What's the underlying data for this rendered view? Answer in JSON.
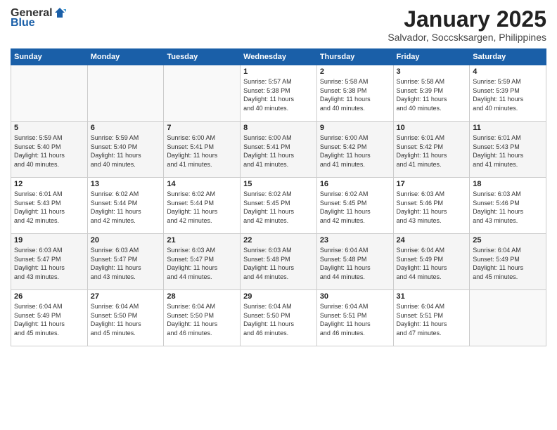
{
  "header": {
    "logo_general": "General",
    "logo_blue": "Blue",
    "title": "January 2025",
    "subtitle": "Salvador, Soccsksargen, Philippines"
  },
  "calendar": {
    "days_of_week": [
      "Sunday",
      "Monday",
      "Tuesday",
      "Wednesday",
      "Thursday",
      "Friday",
      "Saturday"
    ],
    "weeks": [
      [
        {
          "day": "",
          "content": ""
        },
        {
          "day": "",
          "content": ""
        },
        {
          "day": "",
          "content": ""
        },
        {
          "day": "1",
          "content": "Sunrise: 5:57 AM\nSunset: 5:38 PM\nDaylight: 11 hours\nand 40 minutes."
        },
        {
          "day": "2",
          "content": "Sunrise: 5:58 AM\nSunset: 5:38 PM\nDaylight: 11 hours\nand 40 minutes."
        },
        {
          "day": "3",
          "content": "Sunrise: 5:58 AM\nSunset: 5:39 PM\nDaylight: 11 hours\nand 40 minutes."
        },
        {
          "day": "4",
          "content": "Sunrise: 5:59 AM\nSunset: 5:39 PM\nDaylight: 11 hours\nand 40 minutes."
        }
      ],
      [
        {
          "day": "5",
          "content": "Sunrise: 5:59 AM\nSunset: 5:40 PM\nDaylight: 11 hours\nand 40 minutes."
        },
        {
          "day": "6",
          "content": "Sunrise: 5:59 AM\nSunset: 5:40 PM\nDaylight: 11 hours\nand 40 minutes."
        },
        {
          "day": "7",
          "content": "Sunrise: 6:00 AM\nSunset: 5:41 PM\nDaylight: 11 hours\nand 41 minutes."
        },
        {
          "day": "8",
          "content": "Sunrise: 6:00 AM\nSunset: 5:41 PM\nDaylight: 11 hours\nand 41 minutes."
        },
        {
          "day": "9",
          "content": "Sunrise: 6:00 AM\nSunset: 5:42 PM\nDaylight: 11 hours\nand 41 minutes."
        },
        {
          "day": "10",
          "content": "Sunrise: 6:01 AM\nSunset: 5:42 PM\nDaylight: 11 hours\nand 41 minutes."
        },
        {
          "day": "11",
          "content": "Sunrise: 6:01 AM\nSunset: 5:43 PM\nDaylight: 11 hours\nand 41 minutes."
        }
      ],
      [
        {
          "day": "12",
          "content": "Sunrise: 6:01 AM\nSunset: 5:43 PM\nDaylight: 11 hours\nand 42 minutes."
        },
        {
          "day": "13",
          "content": "Sunrise: 6:02 AM\nSunset: 5:44 PM\nDaylight: 11 hours\nand 42 minutes."
        },
        {
          "day": "14",
          "content": "Sunrise: 6:02 AM\nSunset: 5:44 PM\nDaylight: 11 hours\nand 42 minutes."
        },
        {
          "day": "15",
          "content": "Sunrise: 6:02 AM\nSunset: 5:45 PM\nDaylight: 11 hours\nand 42 minutes."
        },
        {
          "day": "16",
          "content": "Sunrise: 6:02 AM\nSunset: 5:45 PM\nDaylight: 11 hours\nand 42 minutes."
        },
        {
          "day": "17",
          "content": "Sunrise: 6:03 AM\nSunset: 5:46 PM\nDaylight: 11 hours\nand 43 minutes."
        },
        {
          "day": "18",
          "content": "Sunrise: 6:03 AM\nSunset: 5:46 PM\nDaylight: 11 hours\nand 43 minutes."
        }
      ],
      [
        {
          "day": "19",
          "content": "Sunrise: 6:03 AM\nSunset: 5:47 PM\nDaylight: 11 hours\nand 43 minutes."
        },
        {
          "day": "20",
          "content": "Sunrise: 6:03 AM\nSunset: 5:47 PM\nDaylight: 11 hours\nand 43 minutes."
        },
        {
          "day": "21",
          "content": "Sunrise: 6:03 AM\nSunset: 5:47 PM\nDaylight: 11 hours\nand 44 minutes."
        },
        {
          "day": "22",
          "content": "Sunrise: 6:03 AM\nSunset: 5:48 PM\nDaylight: 11 hours\nand 44 minutes."
        },
        {
          "day": "23",
          "content": "Sunrise: 6:04 AM\nSunset: 5:48 PM\nDaylight: 11 hours\nand 44 minutes."
        },
        {
          "day": "24",
          "content": "Sunrise: 6:04 AM\nSunset: 5:49 PM\nDaylight: 11 hours\nand 44 minutes."
        },
        {
          "day": "25",
          "content": "Sunrise: 6:04 AM\nSunset: 5:49 PM\nDaylight: 11 hours\nand 45 minutes."
        }
      ],
      [
        {
          "day": "26",
          "content": "Sunrise: 6:04 AM\nSunset: 5:49 PM\nDaylight: 11 hours\nand 45 minutes."
        },
        {
          "day": "27",
          "content": "Sunrise: 6:04 AM\nSunset: 5:50 PM\nDaylight: 11 hours\nand 45 minutes."
        },
        {
          "day": "28",
          "content": "Sunrise: 6:04 AM\nSunset: 5:50 PM\nDaylight: 11 hours\nand 46 minutes."
        },
        {
          "day": "29",
          "content": "Sunrise: 6:04 AM\nSunset: 5:50 PM\nDaylight: 11 hours\nand 46 minutes."
        },
        {
          "day": "30",
          "content": "Sunrise: 6:04 AM\nSunset: 5:51 PM\nDaylight: 11 hours\nand 46 minutes."
        },
        {
          "day": "31",
          "content": "Sunrise: 6:04 AM\nSunset: 5:51 PM\nDaylight: 11 hours\nand 47 minutes."
        },
        {
          "day": "",
          "content": ""
        }
      ]
    ]
  }
}
